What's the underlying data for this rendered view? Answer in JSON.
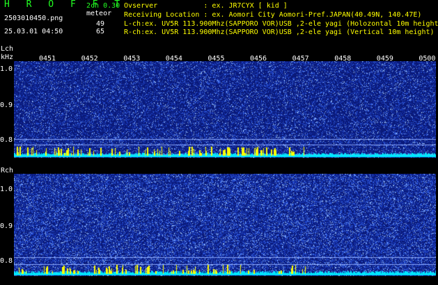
{
  "header": {
    "logo": "H R O F F T",
    "version": "2ch 0.30",
    "filename": "2503010450.png",
    "meteor_label": "meteor",
    "lch_count": "49",
    "rch_count": "65",
    "datetime": "25.03.01 04:50",
    "observer": "Ovserver           : ex. JR7CYX [ kid ]",
    "location": "Receiving Location : ex. Aomori City Aomori-Pref.JAPAN(40.49N, 140.47E)",
    "lch_info": "L-ch:ex. UV5R 113.900Mhz(SAPPORO VOR)USB ,2-ele yagi (Holozontal 10m height",
    "rch_info": "R-ch:ex. UV5R 113.900Mhz(SAPPORO VOR)USB ,2-ele yagi (Vertical 10m height)"
  },
  "lch": {
    "label": "Lch",
    "unit": "kHz",
    "time_ticks": [
      "0451",
      "0452",
      "0453",
      "0454",
      "0455",
      "0456",
      "0457",
      "0458",
      "0459",
      "0500"
    ],
    "freq_ticks": [
      "1.0",
      "0.9",
      "0.8"
    ]
  },
  "rch": {
    "label": "Rch",
    "freq_ticks": [
      "1.0",
      "0.9",
      "0.8"
    ]
  },
  "colors": {
    "background": "#000000",
    "waterfall_base": "#0a1a7a",
    "noise": "#1a3cc0",
    "signal": "#00e8ff",
    "meteor": "#ffff00",
    "logo": "#22ff22",
    "info": "#ffff00"
  }
}
